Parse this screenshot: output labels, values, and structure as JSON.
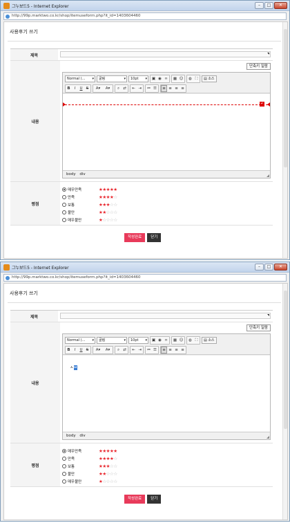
{
  "windows": [
    {
      "title": "그누보드5 - Internet Explorer",
      "url": "http://99p.marktwo.co.kr/shop/itemuseform.php?it_id=1403604460",
      "page_title": "사용후기 쓰기",
      "labels": {
        "subject": "제목",
        "content": "내용",
        "rating": "평점"
      },
      "emoticon_button": "단축키 일람",
      "toolbar": {
        "format": "Normal (...",
        "font": "굴림",
        "size": "10pt",
        "source": "소스",
        "bold": "B",
        "italic": "I",
        "underline": "U",
        "strike": "S"
      },
      "editor_text": "",
      "editor_selected": "",
      "editor_path": "body  div",
      "ratings": [
        {
          "label": "매우만족",
          "stars": 5,
          "checked": true
        },
        {
          "label": "만족",
          "stars": 4,
          "checked": false
        },
        {
          "label": "보통",
          "stars": 3,
          "checked": false
        },
        {
          "label": "불만",
          "stars": 2,
          "checked": false
        },
        {
          "label": "매우불만",
          "stars": 1,
          "checked": false
        }
      ],
      "submit": "작성완료",
      "close": "닫기"
    },
    {
      "title": "그누보드5 - Internet Explorer",
      "url": "http://99p.marktwo.co.kr/shop/itemuseform.php?it_id=1403604460",
      "page_title": "사용후기 쓰기",
      "labels": {
        "subject": "제목",
        "content": "내용",
        "rating": "평점"
      },
      "emoticon_button": "단축키 일람",
      "toolbar": {
        "format": "Normal (...",
        "font": "굴림",
        "size": "10pt",
        "source": "소스",
        "bold": "B",
        "italic": "I",
        "underline": "U",
        "strike": "S"
      },
      "editor_text": "ㅅ",
      "editor_selected": "ㅂ",
      "editor_path": "body  div",
      "ratings": [
        {
          "label": "매우만족",
          "stars": 5,
          "checked": true
        },
        {
          "label": "만족",
          "stars": 4,
          "checked": false
        },
        {
          "label": "보통",
          "stars": 3,
          "checked": false
        },
        {
          "label": "불만",
          "stars": 2,
          "checked": false
        },
        {
          "label": "매우불만",
          "stars": 1,
          "checked": false
        }
      ],
      "submit": "작성완료",
      "close": "닫기"
    }
  ]
}
